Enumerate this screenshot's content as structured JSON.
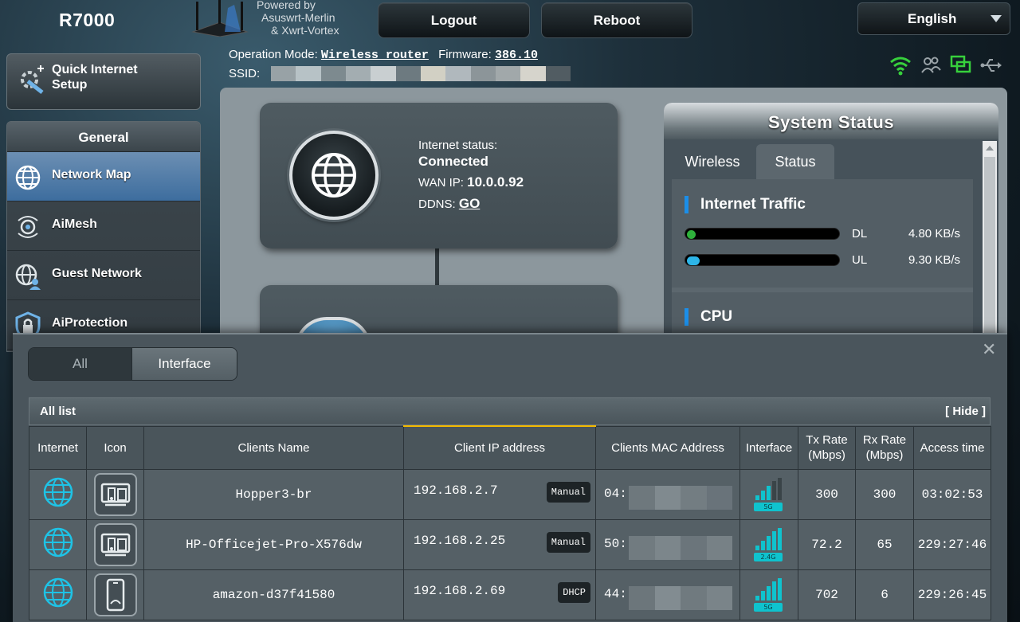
{
  "header": {
    "model": "R7000",
    "powered_by": [
      "Powered by",
      "Asuswrt-Merlin",
      "& Xwrt-Vortex"
    ],
    "logout_label": "Logout",
    "reboot_label": "Reboot",
    "language": "English"
  },
  "info": {
    "op_mode_label": "Operation Mode:",
    "op_mode_value": "Wireless router",
    "firmware_label": "Firmware:",
    "firmware_value": "386.10",
    "ssid_label": "SSID:"
  },
  "sidebar": {
    "qis_label": "Quick Internet Setup",
    "section_title": "General",
    "items": [
      {
        "label": "Network Map",
        "active": true,
        "icon": "network-map-icon"
      },
      {
        "label": "AiMesh",
        "active": false,
        "icon": "aimesh-icon"
      },
      {
        "label": "Guest Network",
        "active": false,
        "icon": "guest-network-icon"
      },
      {
        "label": "AiProtection",
        "active": false,
        "icon": "aiprotection-icon"
      }
    ]
  },
  "internet": {
    "status_label": "Internet status:",
    "status_value": "Connected",
    "wan_ip_label": "WAN IP:",
    "wan_ip_value": "10.0.0.92",
    "ddns_label": "DDNS:",
    "ddns_value": "GO"
  },
  "system_status": {
    "title": "System Status",
    "tabs": [
      "Wireless",
      "Status"
    ],
    "active_tab": "Status",
    "traffic_title": "Internet Traffic",
    "dl_label": "DL",
    "dl_value": "4.80 KB/s",
    "ul_label": "UL",
    "ul_value": "9.30 KB/s",
    "cpu_title": "CPU",
    "colors": {
      "dl": "#2fb13c",
      "ul": "#2db5e8",
      "accent": "#1b8ee8"
    }
  },
  "clients": {
    "tabs": [
      "All",
      "Interface"
    ],
    "active_tab": "Interface",
    "list_title": "All list",
    "hide_label": "[ Hide ]",
    "columns": [
      "Internet",
      "Icon",
      "Clients Name",
      "Client IP address",
      "Clients MAC Address",
      "Interface",
      "Tx Rate (Mbps)",
      "Rx Rate (Mbps)",
      "Access time"
    ],
    "rows": [
      {
        "name": "Hopper3-br",
        "ip": "192.168.2.7",
        "ip_type": "Manual",
        "mac": "04:",
        "band": "5G",
        "tx": "300",
        "rx": "300",
        "time": "03:02:53",
        "device_icon": "pc-device-icon"
      },
      {
        "name": "HP-Officejet-Pro-X576dw",
        "ip": "192.168.2.25",
        "ip_type": "Manual",
        "mac": "50:",
        "band": "2.4G",
        "tx": "72.2",
        "rx": "65",
        "time": "229:27:46",
        "device_icon": "pc-device-icon"
      },
      {
        "name": "amazon-d37f41580",
        "ip": "192.168.2.69",
        "ip_type": "DHCP",
        "mac": "44:",
        "band": "5G",
        "tx": "702",
        "rx": "6",
        "time": "229:26:45",
        "device_icon": "phone-device-icon"
      }
    ]
  }
}
